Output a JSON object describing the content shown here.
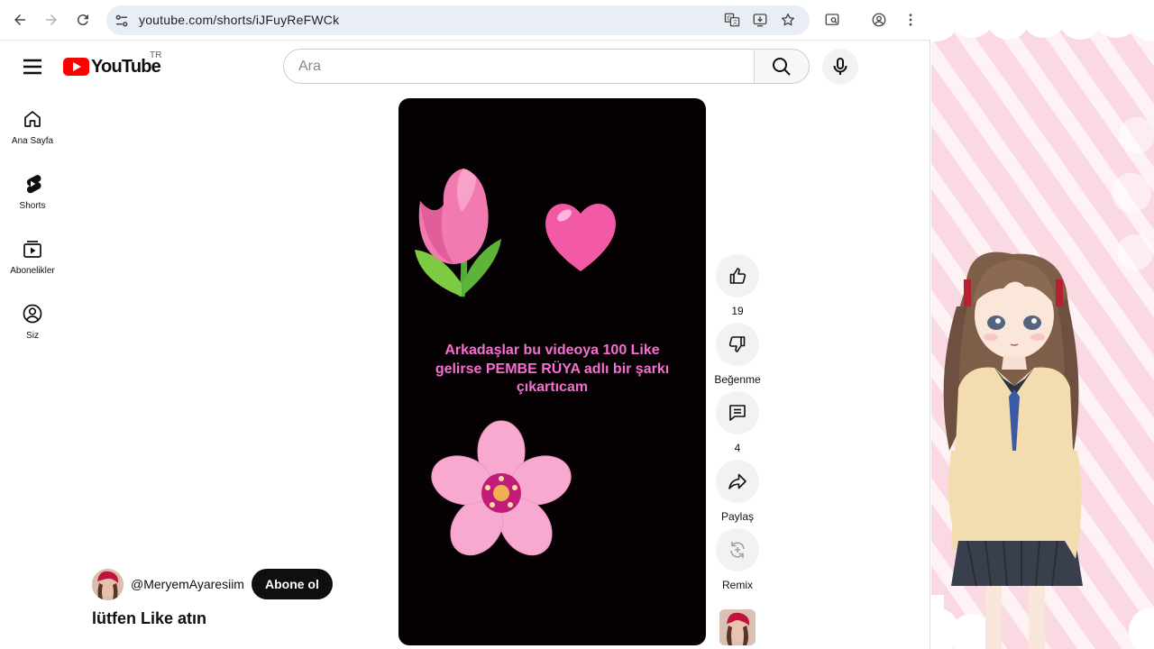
{
  "browser": {
    "url": "youtube.com/shorts/iJFuyReFWCk"
  },
  "masthead": {
    "logo_text": "YouTube",
    "country_code": "TR",
    "search_placeholder": "Ara"
  },
  "guide": {
    "items": [
      {
        "label": "Ana Sayfa",
        "icon": "home-icon"
      },
      {
        "label": "Shorts",
        "icon": "shorts-icon"
      },
      {
        "label": "Abonelikler",
        "icon": "subscriptions-icon"
      },
      {
        "label": "Siz",
        "icon": "you-icon"
      }
    ]
  },
  "short": {
    "caption_lines": [
      "Arkadaşlar bu videoya 100 Like",
      "gelirse PEMBE RÜYA adlı bir şarkı",
      "çıkartıcam"
    ],
    "title": "lütfen Like atın",
    "channel_handle": "@MeryemAyaresiim",
    "subscribe_label": "Abone ol"
  },
  "actions": {
    "like_count": "19",
    "dislike_label": "Beğenme",
    "comment_count": "4",
    "share_label": "Paylaş",
    "remix_label": "Remix"
  },
  "colors": {
    "caption": "#f46fd0",
    "brand_red": "#ff0000",
    "player_bg": "#060103"
  }
}
